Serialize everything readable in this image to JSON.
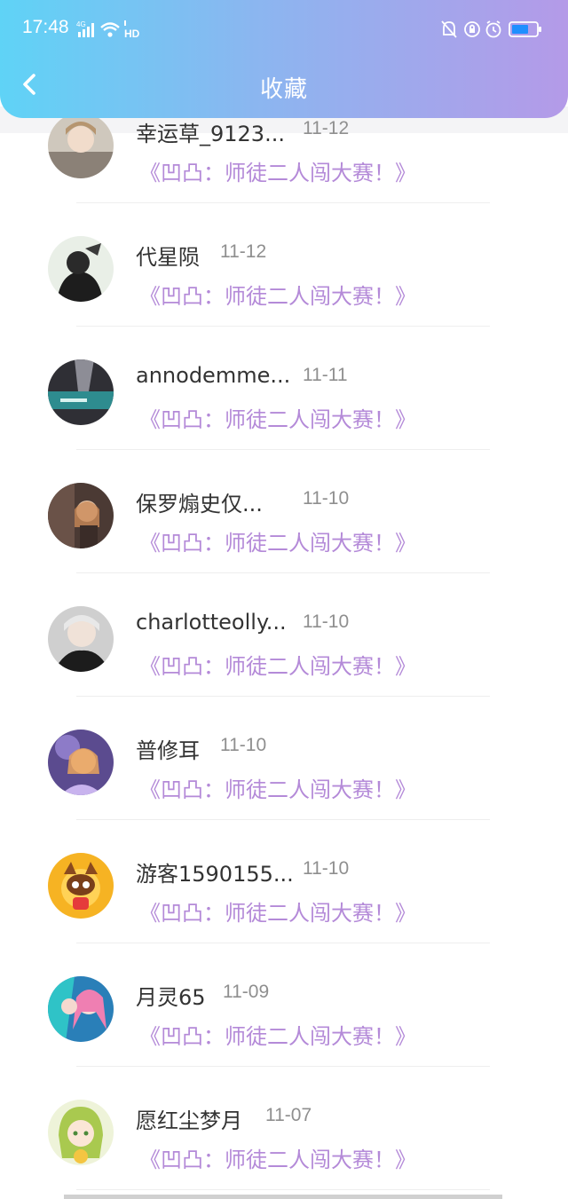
{
  "status": {
    "time": "17:48",
    "network": "4G",
    "hd": "HD"
  },
  "header": {
    "title": "收藏"
  },
  "favorites": [
    {
      "name": "幸运草_9123...",
      "date": "11-12",
      "work": "《凹凸：师徒二人闯大赛！》"
    },
    {
      "name": "代星陨",
      "date": "11-12",
      "work": "《凹凸：师徒二人闯大赛！》"
    },
    {
      "name": "annodemme...",
      "date": "11-11",
      "work": "《凹凸：师徒二人闯大赛！》"
    },
    {
      "name": "保罗煽史仅...",
      "date": "11-10",
      "work": "《凹凸：师徒二人闯大赛！》"
    },
    {
      "name": "charlotteolly...",
      "date": "11-10",
      "work": "《凹凸：师徒二人闯大赛！》"
    },
    {
      "name": "普修耳",
      "date": "11-10",
      "work": "《凹凸：师徒二人闯大赛！》"
    },
    {
      "name": "游客1590155...",
      "date": "11-10",
      "work": "《凹凸：师徒二人闯大赛！》"
    },
    {
      "name": "月灵65",
      "date": "11-09",
      "work": "《凹凸：师徒二人闯大赛！》"
    },
    {
      "name": "愿红尘梦月",
      "date": "11-07",
      "work": "《凹凸：师徒二人闯大赛！》"
    }
  ],
  "colors": {
    "accent": "#b48ad8",
    "header_start": "#5fd3f6",
    "header_end": "#b49ae8"
  }
}
